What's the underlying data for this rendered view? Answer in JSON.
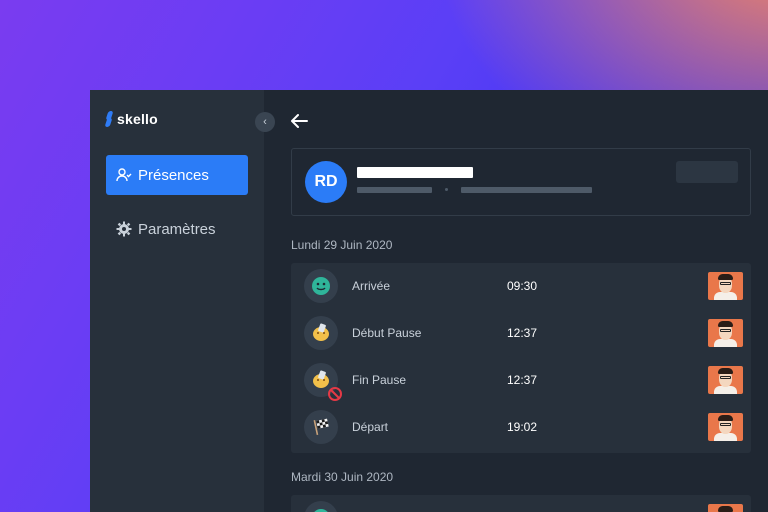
{
  "app": {
    "name": "skello"
  },
  "sidebar": {
    "collapse_icon": "chevron-left-icon",
    "items": [
      {
        "label": "Présences",
        "icon": "user-check-icon",
        "active": true
      },
      {
        "label": "Paramètres",
        "icon": "gear-icon",
        "active": false
      }
    ]
  },
  "header": {
    "back_icon": "arrow-left-icon"
  },
  "profile": {
    "initials": "RD"
  },
  "days": [
    {
      "date": "Lundi 29 Juin 2020",
      "events": [
        {
          "label": "Arrivée",
          "time": "09:30",
          "icon": "smiley-face-icon"
        },
        {
          "label": "Début Pause",
          "time": "12:37",
          "icon": "coffee-break-icon"
        },
        {
          "label": "Fin Pause",
          "time": "12:37",
          "icon": "coffee-break-ended-icon"
        },
        {
          "label": "Départ",
          "time": "19:02",
          "icon": "checkered-flag-icon"
        }
      ]
    },
    {
      "date": "Mardi 30 Juin 2020",
      "events": []
    }
  ],
  "colors": {
    "accent": "#2b7cf7",
    "sidebar": "#27303b",
    "background": "#1f2732",
    "photo_bg": "#e9774a"
  }
}
